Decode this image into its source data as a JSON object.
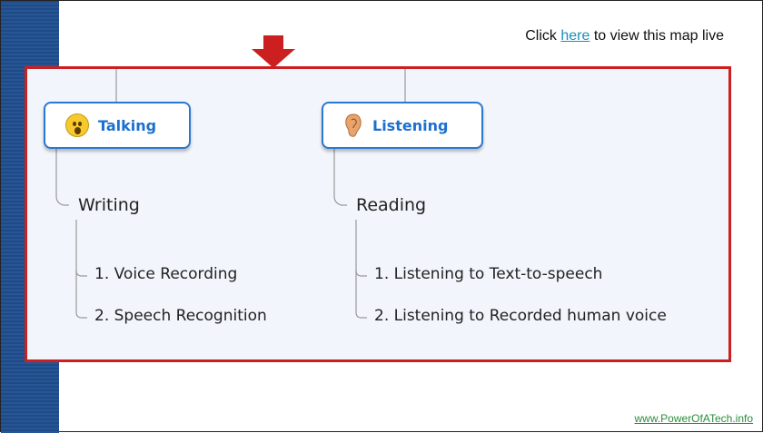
{
  "header": {
    "prefix": "Click ",
    "link_text": "here",
    "suffix": " to view this map live"
  },
  "footer": {
    "site_link": "www.PowerOfATech.info"
  },
  "mindmap": {
    "branches": [
      {
        "icon": "surprised-face-icon",
        "label": "Talking",
        "topic": "Writing",
        "items": [
          "1. Voice Recording",
          "2. Speech Recognition"
        ]
      },
      {
        "icon": "ear-icon",
        "label": "Listening",
        "topic": "Reading",
        "items": [
          "1. Listening to Text-to-speech",
          "2. Listening to Recorded human voice"
        ]
      }
    ]
  },
  "colors": {
    "panel_border": "#cc1f1f",
    "arrow": "#cc1f1f",
    "node_border": "#2a79d0",
    "node_text": "#1a6fcf",
    "left_band": "#1f4e8f",
    "link": "#1a8fb8",
    "footer_link": "#2a8c3c"
  }
}
